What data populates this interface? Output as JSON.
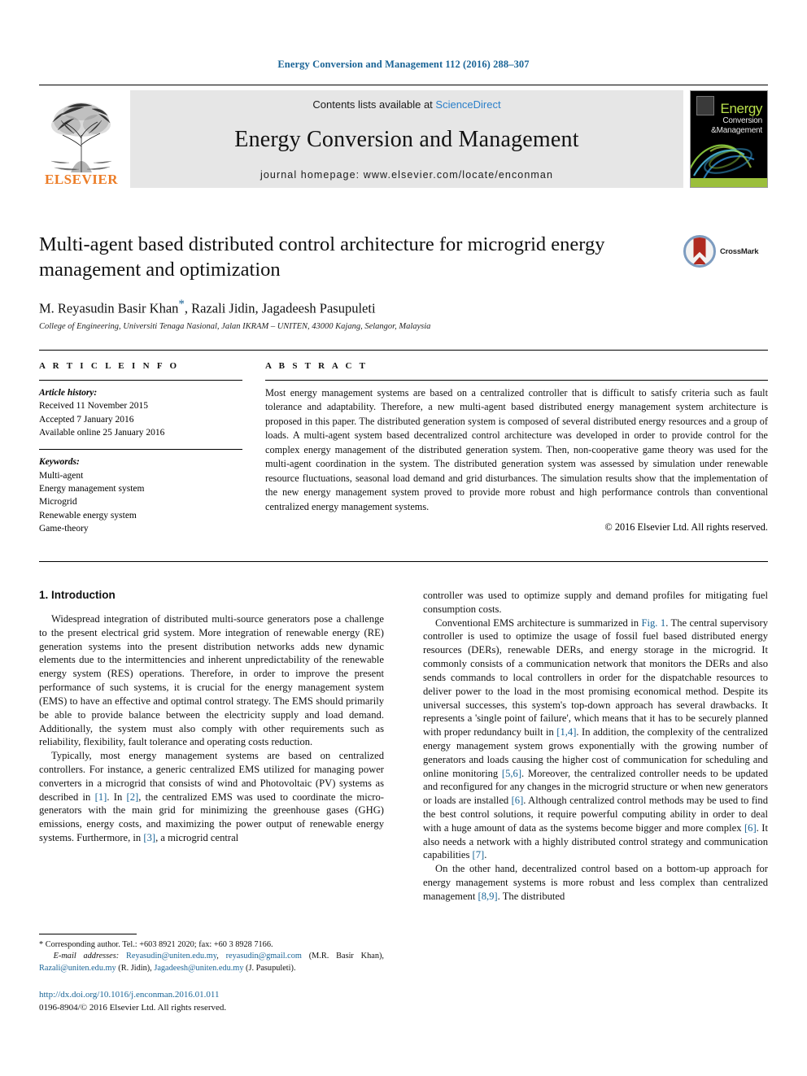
{
  "running_head": "Energy Conversion and Management 112 (2016) 288–307",
  "masthead": {
    "contents_prefix": "Contents lists available at ",
    "sciencedirect": "ScienceDirect",
    "journal_title": "Energy Conversion and Management",
    "homepage": "journal homepage: www.elsevier.com/locate/enconman",
    "publisher": "ELSEVIER",
    "cover": {
      "line1": "Energy",
      "line2": "Conversion",
      "line3": "&Management"
    }
  },
  "title_block": {
    "title": "Multi-agent based distributed control architecture for microgrid energy management and optimization",
    "authors_pre": "M. Reyasudin Basir Khan",
    "author_star": "*",
    "authors_post": ", Razali Jidin, Jagadeesh Pasupuleti",
    "affiliation": "College of Engineering, Universiti Tenaga Nasional, Jalan IKRAM – UNITEN, 43000 Kajang, Selangor, Malaysia",
    "crossmark_label": "CrossMark"
  },
  "article_info": {
    "heading": "A R T I C L E   I N F O",
    "history_label": "Article history:",
    "history": [
      "Received 11 November 2015",
      "Accepted 7 January 2016",
      "Available online 25 January 2016"
    ],
    "keywords_label": "Keywords:",
    "keywords": [
      "Multi-agent",
      "Energy management system",
      "Microgrid",
      "Renewable energy system",
      "Game-theory"
    ]
  },
  "abstract": {
    "heading": "A B S T R A C T",
    "text": "Most energy management systems are based on a centralized controller that is difficult to satisfy criteria such as fault tolerance and adaptability. Therefore, a new multi-agent based distributed energy management system architecture is proposed in this paper. The distributed generation system is composed of several distributed energy resources and a group of loads. A multi-agent system based decentralized control architecture was developed in order to provide control for the complex energy management of the distributed generation system. Then, non-cooperative game theory was used for the multi-agent coordination in the system. The distributed generation system was assessed by simulation under renewable resource fluctuations, seasonal load demand and grid disturbances. The simulation results show that the implementation of the new energy management system proved to provide more robust and high performance controls than conventional centralized energy management systems.",
    "copyright": "© 2016 Elsevier Ltd. All rights reserved."
  },
  "body": {
    "section_heading": "1. Introduction",
    "left_paragraphs": [
      "Widespread integration of distributed multi-source generators pose a challenge to the present electrical grid system. More integration of renewable energy (RE) generation systems into the present distribution networks adds new dynamic elements due to the intermittencies and inherent unpredictability of the renewable energy system (RES) operations. Therefore, in order to improve the present performance of such systems, it is crucial for the energy management system (EMS) to have an effective and optimal control strategy. The EMS should primarily be able to provide balance between the electricity supply and load demand. Additionally, the system must also comply with other requirements such as reliability, flexibility, fault tolerance and operating costs reduction."
    ],
    "left_para2_parts": [
      "Typically, most energy management systems are based on centralized controllers. For instance, a generic centralized EMS utilized for managing power converters in a microgrid that consists of wind and Photovoltaic (PV) systems as described in ",
      "[1]",
      ". In ",
      "[2]",
      ", the centralized EMS was used to coordinate the micro-generators with the main grid for minimizing the greenhouse gases (GHG) emissions, energy costs, and maximizing the power output of renewable energy systems. Furthermore, in ",
      "[3]",
      ", a microgrid central"
    ],
    "right_para1": "controller was used to optimize supply and demand profiles for mitigating fuel consumption costs.",
    "right_para2_parts": [
      "Conventional EMS architecture is summarized in ",
      "Fig. 1",
      ". The central supervisory controller is used to optimize the usage of fossil fuel based distributed energy resources (DERs), renewable DERs, and energy storage in the microgrid. It commonly consists of a communication network that monitors the DERs and also sends commands to local controllers in order for the dispatchable resources to deliver power to the load in the most promising economical method. Despite its universal successes, this system's top-down approach has several drawbacks. It represents a 'single point of failure', which means that it has to be securely planned with proper redundancy built in ",
      "[1,4]",
      ". In addition, the complexity of the centralized energy management system grows exponentially with the growing number of generators and loads causing the higher cost of communication for scheduling and online monitoring ",
      "[5,6]",
      ". Moreover, the centralized controller needs to be updated and reconfigured for any changes in the microgrid structure or when new generators or loads are installed ",
      "[6]",
      ". Although centralized control methods may be used to find the best control solutions, it require powerful computing ability in order to deal with a huge amount of data as the systems become bigger and more complex ",
      "[6]",
      ". It also needs a network with a highly distributed control strategy and communication capabilities ",
      "[7]",
      "."
    ],
    "right_para3_parts": [
      "On the other hand, decentralized control based on a bottom-up approach for energy management systems is more robust and less complex than centralized management ",
      "[8,9]",
      ". The distributed"
    ]
  },
  "footnotes": {
    "corresponding": "* Corresponding author. Tel.: +603 8921 2020; fax: +60 3 8928 7166.",
    "email_label": "E-mail addresses:",
    "email_1": "Reyasudin@uniten.edu.my",
    "email_2": "reyasudin@gmail.com",
    "email_1_owner": " (M.R. Basir Khan), ",
    "email_3": "Razali@uniten.edu.my",
    "email_3_owner": " (R. Jidin), ",
    "email_4": "Jagadeesh@uniten.edu.my",
    "email_4_owner": " (J. Pasupuleti)."
  },
  "bottom": {
    "doi": "http://dx.doi.org/10.1016/j.enconman.2016.01.011",
    "issn": "0196-8904/© 2016 Elsevier Ltd. All rights reserved."
  }
}
